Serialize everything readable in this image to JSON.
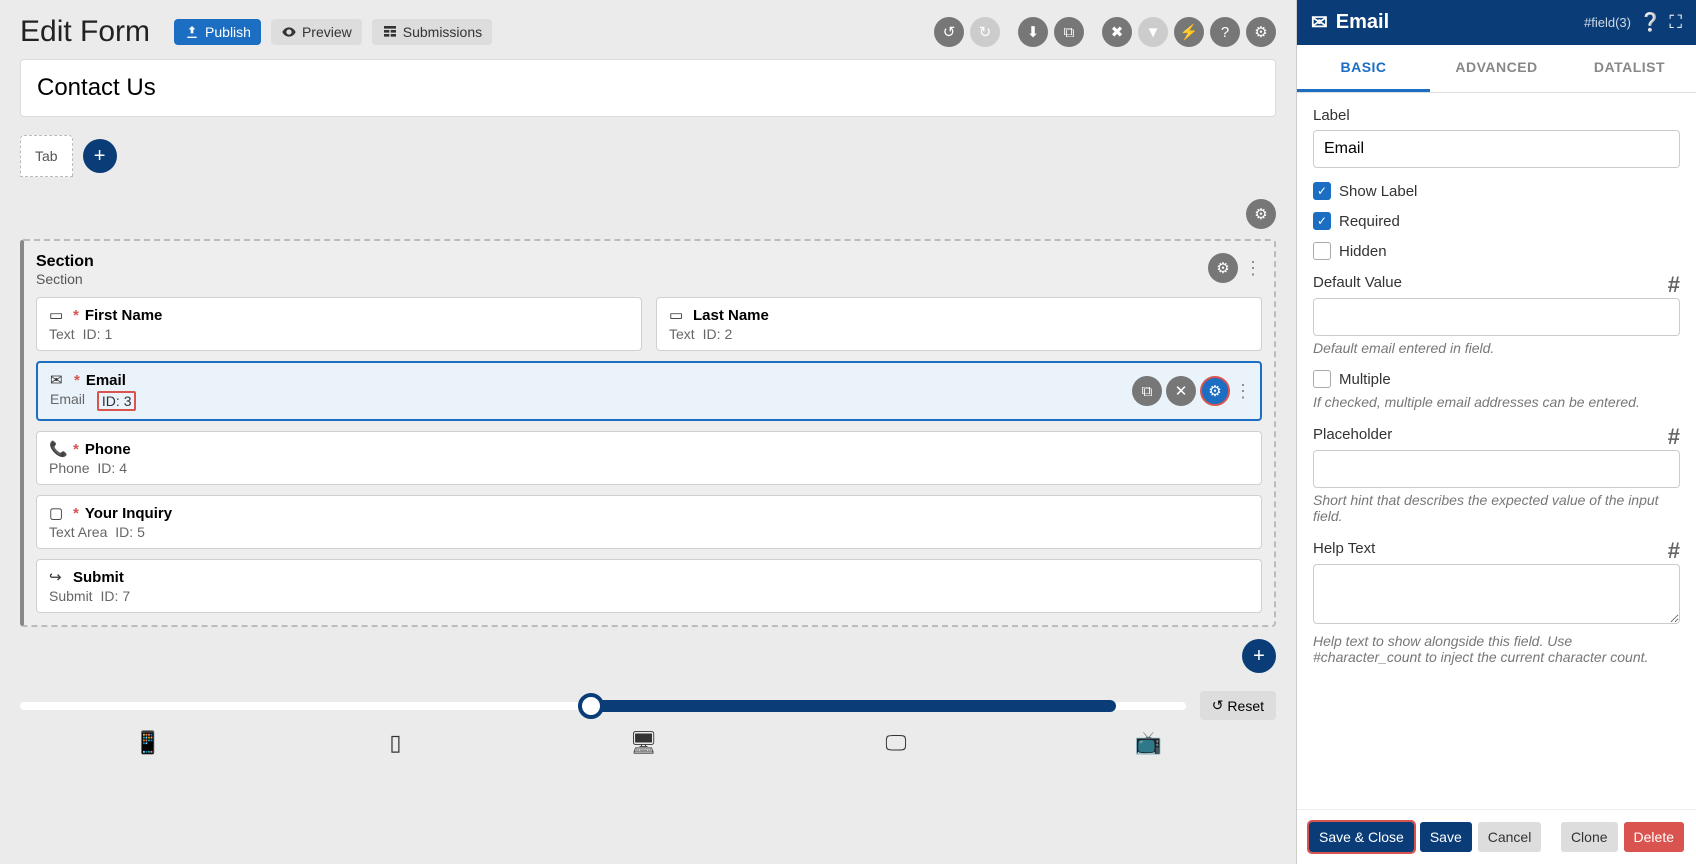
{
  "header": {
    "page_title": "Edit Form",
    "publish": "Publish",
    "preview": "Preview",
    "submissions": "Submissions"
  },
  "form_title": "Contact Us",
  "tab_label": "Tab",
  "section": {
    "title": "Section",
    "sub": "Section"
  },
  "fields": [
    {
      "label": "First Name",
      "type": "Text",
      "id": "1",
      "required": true,
      "icon": "text"
    },
    {
      "label": "Last Name",
      "type": "Text",
      "id": "2",
      "required": false,
      "icon": "text"
    },
    {
      "label": "Email",
      "type": "Email",
      "id": "3",
      "required": true,
      "icon": "email",
      "selected": true,
      "id_highlight": true
    },
    {
      "label": "Phone",
      "type": "Phone",
      "id": "4",
      "required": true,
      "icon": "phone"
    },
    {
      "label": "Your Inquiry",
      "type": "Text Area",
      "id": "5",
      "required": true,
      "icon": "textarea"
    },
    {
      "label": "Submit",
      "type": "Submit",
      "id": "7",
      "required": false,
      "icon": "submit"
    }
  ],
  "reset_label": "Reset",
  "right_panel": {
    "header_title": "Email",
    "field_id": "#field(3)",
    "tabs": {
      "basic": "BASIC",
      "advanced": "ADVANCED",
      "datalist": "DATALIST"
    },
    "label_label": "Label",
    "label_value": "Email",
    "show_label": "Show Label",
    "required": "Required",
    "hidden": "Hidden",
    "default_value_label": "Default Value",
    "default_value_help": "Default email entered in field.",
    "multiple": "Multiple",
    "multiple_help": "If checked, multiple email addresses can be entered.",
    "placeholder_label": "Placeholder",
    "placeholder_help": "Short hint that describes the expected value of the input field.",
    "helptext_label": "Help Text",
    "helptext_help": "Help text to show alongside this field. Use #character_count to inject the current character count.",
    "footer": {
      "save_close": "Save & Close",
      "save": "Save",
      "cancel": "Cancel",
      "clone": "Clone",
      "delete": "Delete"
    }
  }
}
